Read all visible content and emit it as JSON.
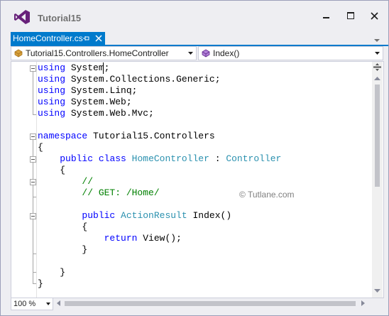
{
  "window": {
    "title": "Tutorial15",
    "logo_icon": "visual-studio-logo",
    "controls": [
      "minimize-icon",
      "maximize-icon",
      "close-icon"
    ]
  },
  "tab": {
    "label": "HomeController.cs",
    "active_color": "#007acc"
  },
  "navigation": {
    "type_combo": "Tutorial15.Controllers.HomeController",
    "member_combo": "Index()"
  },
  "code": {
    "lines": [
      "using System;",
      "using System.Collections.Generic;",
      "using System.Linq;",
      "using System.Web;",
      "using System.Web.Mvc;",
      "",
      "namespace Tutorial15.Controllers",
      "{",
      "    public class HomeController : Controller",
      "    {",
      "        //",
      "        // GET: /Home/",
      "",
      "        public ActionResult Index()",
      "        {",
      "            return View();",
      "        }",
      "",
      "    }",
      "}"
    ],
    "colors": {
      "keyword": "#0000ff",
      "type": "#2b91af",
      "comment": "#008000"
    }
  },
  "watermark": "© Tutlane.com",
  "zoom": {
    "value": "100 %"
  }
}
